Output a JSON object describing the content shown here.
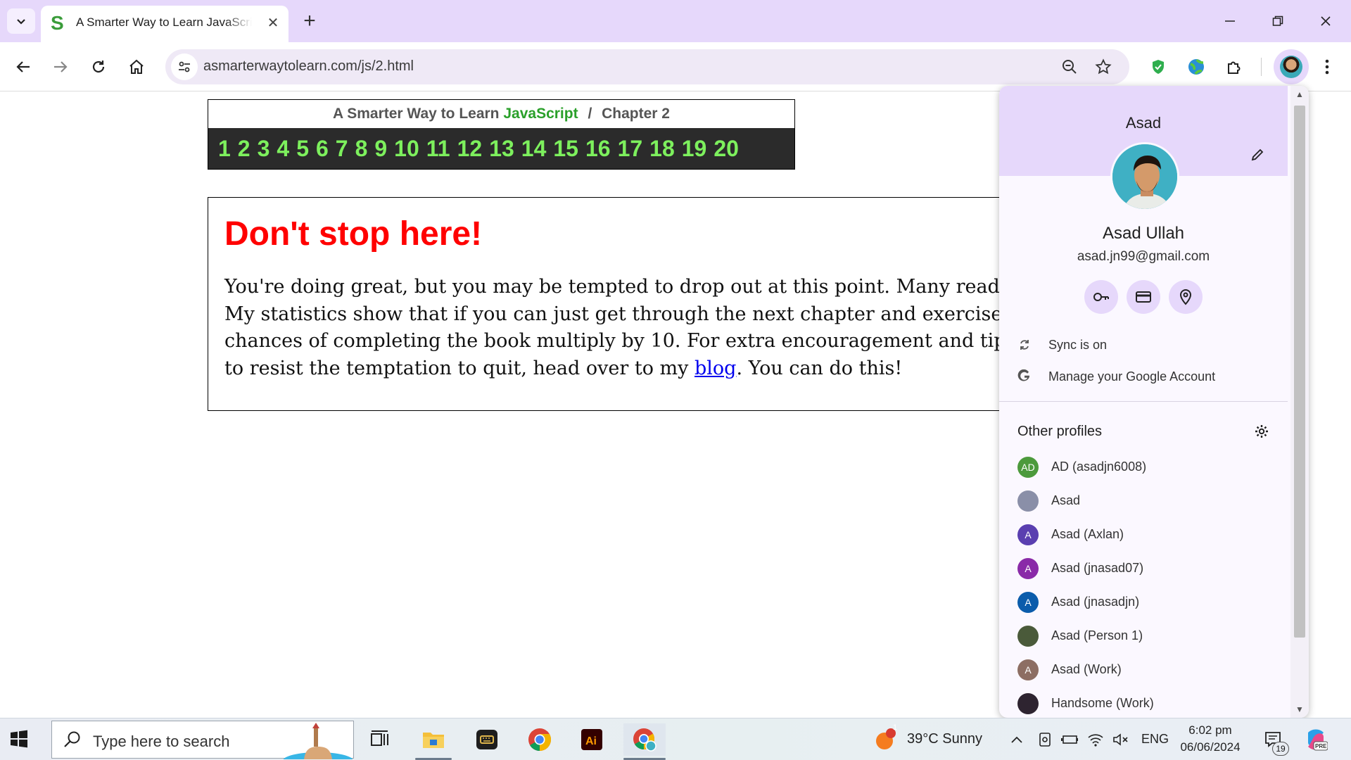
{
  "browser": {
    "tab": {
      "favicon": "S",
      "title": "A Smarter Way to Learn JavaScript"
    },
    "url": "asmarterwaytolearn.com/js/2.html"
  },
  "page": {
    "header": {
      "prefix": "A Smarter Way to Learn",
      "brand": "JavaScript",
      "separator": "/",
      "chapter": "Chapter 2"
    },
    "chapters": [
      "1",
      "2",
      "3",
      "4",
      "5",
      "6",
      "7",
      "8",
      "9",
      "10",
      "11",
      "12",
      "13",
      "14",
      "15",
      "16",
      "17",
      "18",
      "19",
      "20"
    ],
    "message": {
      "title": "Don't stop here!",
      "line1": "You're doing great, but you may be tempted to drop out at this point. Many readers do.",
      "line2": "My statistics show that if you can just get through the next chapter and exercises, your",
      "line3": "chances of completing the book multiply by 10. For extra encouragement and tips on how",
      "line4_before": "to resist the temptation to quit, head over to my ",
      "link": "blog",
      "line4_after": ". You can do this!"
    }
  },
  "profile_panel": {
    "header_name": "Asad",
    "full_name": "Asad Ullah",
    "email": "asad.jn99@gmail.com",
    "sync": "Sync is on",
    "manage": "Manage your Google Account",
    "other_profiles_title": "Other profiles",
    "profiles": [
      {
        "initials": "AD",
        "name": "AD (asadjn6008)",
        "color": "#4c9a3c"
      },
      {
        "initials": "",
        "name": "Asad",
        "color": "#8a8fa8"
      },
      {
        "initials": "A",
        "name": "Asad (Axlan)",
        "color": "#5a3fb0"
      },
      {
        "initials": "A",
        "name": "Asad (jnasad07)",
        "color": "#8a2aa8"
      },
      {
        "initials": "A",
        "name": "Asad (jnasadjn)",
        "color": "#0b5cab"
      },
      {
        "initials": "",
        "name": "Asad (Person 1)",
        "color": "#4a5a3a"
      },
      {
        "initials": "A",
        "name": "Asad (Work)",
        "color": "#8d6e63"
      },
      {
        "initials": "",
        "name": "Handsome (Work)",
        "color": "#2e2430"
      }
    ]
  },
  "taskbar": {
    "search_placeholder": "Type here to search",
    "weather": "39°C  Sunny",
    "weather_badge": "1",
    "language": "ENG",
    "time": "6:02 pm",
    "date": "06/06/2024",
    "notification_count": "19"
  }
}
